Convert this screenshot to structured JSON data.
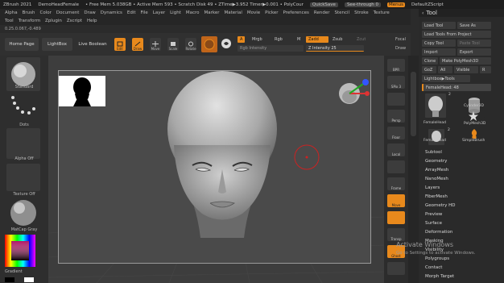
{
  "titlebar": {
    "app": "ZBrush 2021",
    "doc": "DemoHeadFemale",
    "stats": "• Free Mem 5.038GB • Active Mem 593 • Scratch Disk 49 • ZTime▶3.952 Timer▶0.001 • PolyCour",
    "quicksave": "QuickSave",
    "seethrough": "See-through 0",
    "menus": "Menus",
    "script": "DefaultZScript"
  },
  "menu1": [
    "Alpha",
    "Brush",
    "Color",
    "Document",
    "Draw",
    "Dynamics",
    "Edit",
    "File",
    "Layer",
    "Light",
    "Macro",
    "Marker",
    "Material",
    "Movie",
    "Picker",
    "Preferences",
    "Render",
    "Stencil",
    "Stroke",
    "Texture"
  ],
  "menu2": [
    "Tool",
    "Transform",
    "Zplugin",
    "Zscript",
    "Help"
  ],
  "infoline": "0.25.0.067,-0.489",
  "shelf": {
    "home": "Home Page",
    "lightbox": "LightBox",
    "liveboolean": "Live Boolean",
    "edit": "Edit",
    "draw": "Draw",
    "move": "Move",
    "scale": "Scale",
    "rotate": "Rotate",
    "a": "A",
    "mrgb": "Mrgb",
    "rgb": "Rgb",
    "m": "M",
    "zadd": "Zadd",
    "zsub": "Zsub",
    "zcut": "Zcut",
    "rgbintensity": "Rgb Intensity",
    "zintensity": "Z Intensity 25",
    "focal": "Focal",
    "drawsize": "Draw"
  },
  "left": {
    "standard": "Standard",
    "dots": "Dots",
    "alphaoff": "Alpha Off",
    "textureoff": "Texture Off",
    "matcap": "MatCap Gray",
    "gradient": "Gradient"
  },
  "rightstrip": [
    "BPR",
    "SPix 3",
    "",
    "Persp",
    "Floor",
    "Local",
    "",
    "Frame",
    "Move",
    "",
    "Transp",
    "Ghost",
    ""
  ],
  "toolpanel": {
    "title": "Tool",
    "loadtool": "Load Tool",
    "saveas": "Save As",
    "loadproject": "Load Tools From Project",
    "copytool": "Copy Tool",
    "pastetool": "Paste Tool",
    "import": "Import",
    "export": "Export",
    "clone": "Clone",
    "makepoly": "Make PolyMesh3D",
    "goz": "GoZ",
    "all": "All",
    "visible": "Visible",
    "r": "R",
    "lightboxtools": "Lightbox▶Tools",
    "currenttool": "FemaleHead: 48",
    "thumbs": [
      {
        "label": "FemaleHead",
        "count": "2"
      },
      {
        "label": "Cylinder3D",
        "count": ""
      },
      {
        "label": "PolyMesh3D",
        "count": ""
      },
      {
        "label": "FemaleHead",
        "count": "2"
      },
      {
        "label": "SimpleBrush",
        "count": ""
      }
    ],
    "items": [
      "Subtool",
      "Geometry",
      "ArrayMesh",
      "NanoMesh",
      "Layers",
      "FiberMesh",
      "Geometry HD",
      "Preview",
      "Surface",
      "Deformation",
      "Masking",
      "Visibility",
      "Polygroups",
      "Contact",
      "Morph Target"
    ]
  },
  "watermark": {
    "line1": "Activate Windows",
    "line2": "Go to Settings to activate Windows."
  },
  "colors": {
    "accent": "#e8891c",
    "panel": "#2e2e2e",
    "viewport": "#3d3d3d"
  }
}
